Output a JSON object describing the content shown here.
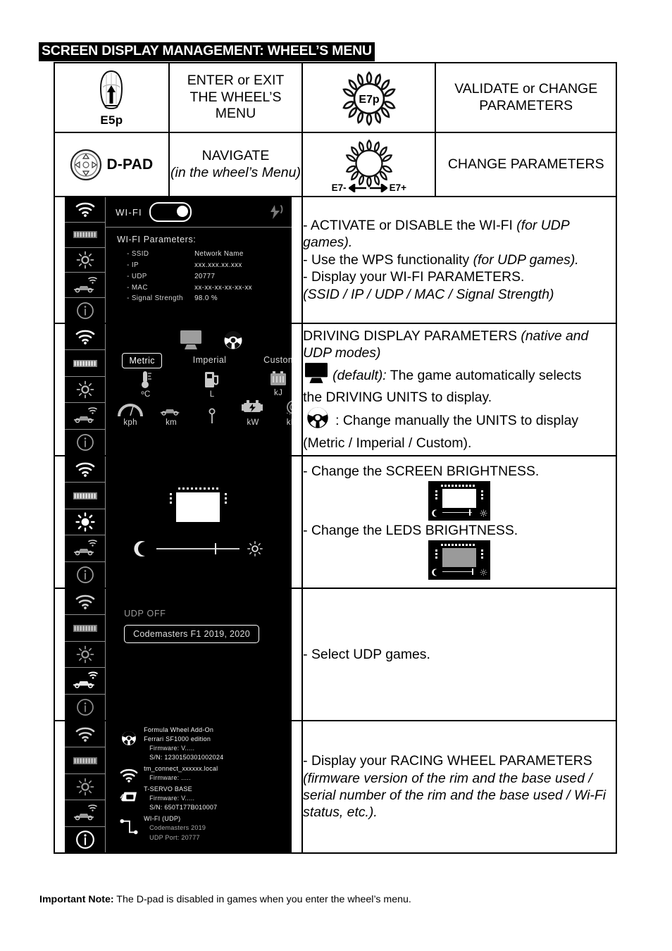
{
  "title": "SCREEN DISPLAY MANAGEMENT: WHEEL’S MENU",
  "controls": [
    {
      "icon_name": "paddle-e5p-icon",
      "icon_label": "E5p",
      "action_line1": "ENTER or EXIT",
      "action_line2": "THE WHEEL’S MENU",
      "icon2_name": "encoder-e7p-icon",
      "icon2_label": "E7p",
      "action2_line1": "VALIDATE or CHANGE",
      "action2_line2": "PARAMETERS"
    },
    {
      "icon_name": "d-pad-icon",
      "icon_label": "D-PAD",
      "action_line1": "NAVIGATE",
      "action_line2": "(in the wheel’s Menu)",
      "icon2_name": "encoder-rotate-icon",
      "icon2_label_left": "E7-",
      "icon2_label_right": "E7+",
      "action2_line1": "CHANGE PARAMETERS"
    }
  ],
  "sidebar_icons": [
    "wifi-icon",
    "led-strip-icon",
    "brightness-sun-icon",
    "f1-car-wifi-icon",
    "info-icon"
  ],
  "rows": {
    "wifi": {
      "screen": {
        "toggle_label": "WI-FI",
        "toggle_state": "on",
        "wps_icon": "wps-icon",
        "params_title": "WI-FI Parameters:",
        "params": [
          {
            "key": "- SSID",
            "value": "Network Name"
          },
          {
            "key": "- IP",
            "value": "xxx.xxx.xx.xxx"
          },
          {
            "key": "- UDP",
            "value": "20777"
          },
          {
            "key": "- MAC",
            "value": "xx-xx-xx-xx-xx-xx"
          },
          {
            "key": "- Signal Strength",
            "value": "98.0 %"
          }
        ]
      },
      "desc": {
        "l1a": "- ACTIVATE or DISABLE the WI-FI ",
        "l1b": "(for UDP",
        "l2": "games).",
        "l3a": "- Use the WPS functionality ",
        "l3b": "(for UDP games).",
        "l4": " - Display your WI-FI PARAMETERS.",
        "l5": "(SSID / IP / UDP / MAC / Signal Strength)"
      }
    },
    "units": {
      "screen": {
        "mode_icons": [
          "monitor-icon",
          "steering-wheel-icon"
        ],
        "tabs": [
          "Metric",
          "Imperial",
          "Custom"
        ],
        "selected_tab": "Metric",
        "units_row1": [
          {
            "icon": "thermometer-icon",
            "label": "ºC"
          },
          {
            "icon": "fuel-pump-icon",
            "label": "L"
          },
          {
            "icon": "battery-icon",
            "label": "kJ"
          }
        ],
        "units_row2": [
          {
            "icon": "speedometer-icon",
            "label": "kph"
          },
          {
            "icon": "f1-car-icon",
            "label": "km"
          },
          {
            "icon": "tyre-temp-icon",
            "label": ""
          },
          {
            "icon": "engine-power-icon",
            "label": "kW"
          },
          {
            "icon": "tyre-pressure-icon",
            "label": "kPa"
          }
        ]
      },
      "desc": {
        "l1a": "DRIVING DISPLAY PARAMETERS ",
        "l1b": "(native and",
        "l2": "UDP modes)",
        "l3a": "(default):",
        "l3b": " The game automatically selects",
        "l4": "the DRIVING UNITS to display.",
        "l5a": ": Change manually the UNITS to display",
        "l6": "(Metric / Imperial / Custom)."
      }
    },
    "brightness": {
      "screen": {
        "moon_icon": "moon-icon",
        "sun_icon": "sun-icon",
        "slider_position_pct": 70
      },
      "desc": {
        "l1": "- Change the SCREEN BRIGHTNESS.",
        "thumb1": "screen-brightness-thumbnail",
        "l2": "- Change the LEDS BRIGHTNESS.",
        "thumb2": "leds-brightness-thumbnail"
      }
    },
    "udp": {
      "screen": {
        "status": "UDP OFF",
        "selected_game": "Codemasters F1 2019, 2020"
      },
      "desc": {
        "l1": "- Select UDP games."
      }
    },
    "info": {
      "screen": {
        "entries": [
          {
            "icon": "steering-wheel-icon",
            "line1": "Formula Wheel Add-On",
            "line2": "Ferrari SF1000 edition",
            "line3": "Firmware: V.....",
            "line4": "S/N: 1230150301002024"
          },
          {
            "icon": "wifi-icon",
            "line1": "tm_connect_xxxxxx.local",
            "line3": "Firmware: ....."
          },
          {
            "icon": "servo-base-icon",
            "line1": "T-SERVO BASE",
            "line3": "Firmware: V.....",
            "line4": "S/N: 650T177B010007"
          },
          {
            "icon": "udp-link-icon",
            "line1": "WI-FI (UDP)",
            "line3": "Codemasters 2019",
            "line4": "UDP Port: 20777"
          }
        ]
      },
      "desc": {
        "l1": "- Display your RACING WHEEL PARAMETERS",
        "l2": "(firmware version of the rim and the base used /",
        "l3": "serial number of the rim and the base used / Wi-Fi",
        "l4": "status, etc.)."
      }
    }
  },
  "footer": {
    "label": "Important Note:",
    "text": " The D-pad is disabled in games when you enter the wheel’s menu."
  }
}
